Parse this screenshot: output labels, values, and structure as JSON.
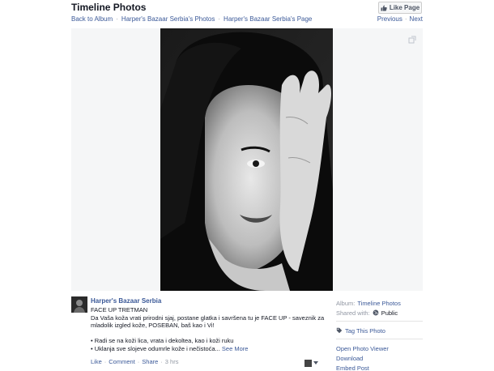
{
  "header": {
    "title": "Timeline Photos",
    "like_page_label": "Like Page"
  },
  "breadcrumbs": [
    "Back to Album",
    "Harper's Bazaar Serbia's Photos",
    "Harper's Bazaar Serbia's Page"
  ],
  "breadcrumb_separator": "·",
  "pager": {
    "previous": "Previous",
    "next": "Next",
    "separator": "·"
  },
  "post": {
    "author": "Harper's Bazaar Serbia",
    "lines": [
      "FACE UP TRETMAN",
      "Da Vaša koža vrati prirodni sjaj, postane glatka i savršena tu je FACE UP - saveznik za",
      "mladolik izgled kože, POSEBAN, baš kao i Vi!"
    ],
    "bullets": [
      "• Radi se na koži lica, vrata i dekoltea, kao i koži ruku",
      "• Uklanja sve slojeve odumrle kože i nečistoća..."
    ],
    "see_more": "See More",
    "actions": {
      "like": "Like",
      "comment": "Comment",
      "share": "Share",
      "time": "3 hrs",
      "separator": "·"
    }
  },
  "sidebar": {
    "album_label": "Album:",
    "album_value": "Timeline Photos",
    "shared_label": "Shared with:",
    "shared_value": "Public",
    "tag_photo": "Tag This Photo",
    "open_viewer": "Open Photo Viewer",
    "download": "Download",
    "embed": "Embed Post"
  },
  "colors": {
    "link": "#3b5998",
    "muted": "#9197a3",
    "stage_bg": "#f5f6f7"
  },
  "icons": [
    "thumbs-up-icon",
    "expand-icon",
    "globe-icon",
    "tag-icon",
    "chevron-down-icon"
  ]
}
